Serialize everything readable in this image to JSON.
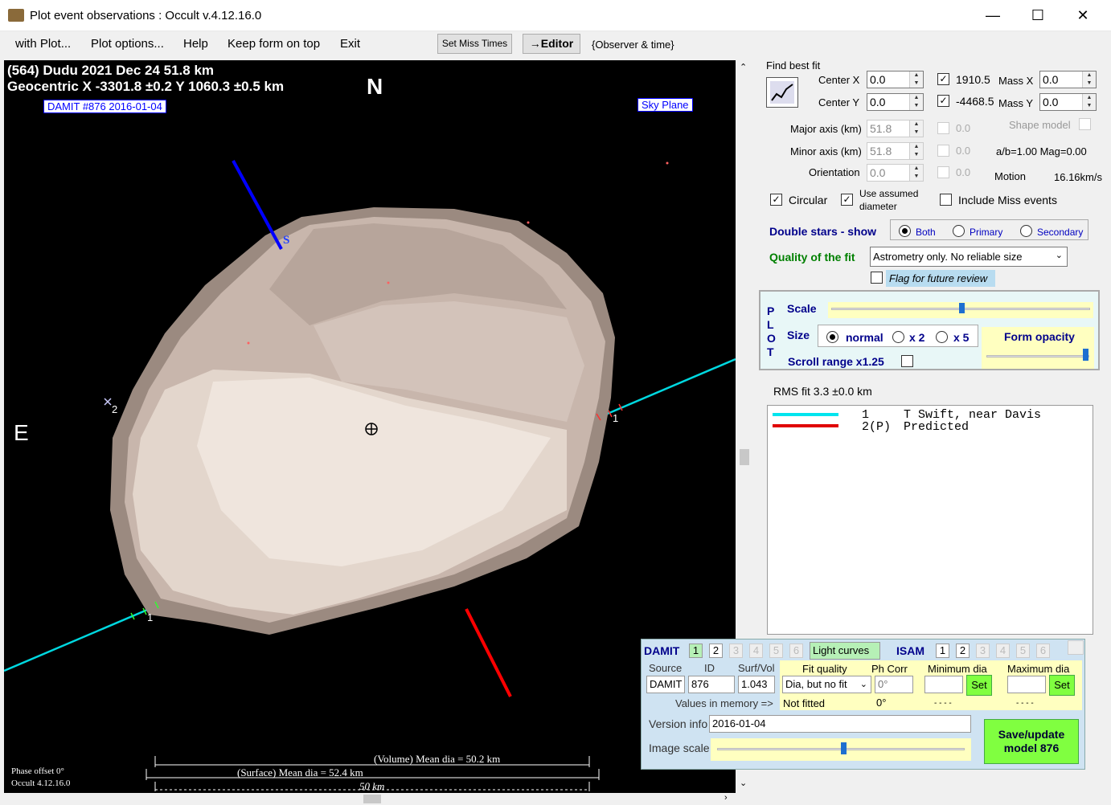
{
  "window": {
    "title": "Plot event observations : Occult v.4.12.16.0"
  },
  "menu": {
    "items": [
      "with Plot...",
      "Plot options...",
      "Help",
      "Keep form on top",
      "Exit"
    ],
    "set_miss_times": "Set Miss Times",
    "editor": "→Editor",
    "observer_time": "{Observer & time}"
  },
  "plot": {
    "title_line1": "(564) Dudu  2021 Dec 24   51.8 km",
    "title_line2": "Geocentric  X  -3301.8 ±0.2  Y 1060.3 ±0.5 km",
    "damit_label": "DAMIT #876 2016-01-04",
    "sky_plane": "Sky Plane",
    "north": "N",
    "east": "E",
    "south_marker": "S",
    "chord_label_1a": "1",
    "chord_label_1b": "1",
    "star_label": "2",
    "volume_dia": "(Volume) Mean dia = 50.2 km",
    "surface_dia": "(Surface) Mean dia = 52.4 km",
    "scale_bar": "50 km",
    "phase_offset": "Phase offset 0°",
    "occult_version": "Occult 4.12.16.0"
  },
  "fit": {
    "find_best_fit": "Find best fit",
    "center_x_label": "Center X",
    "center_x": "0.0",
    "center_y_label": "Center Y",
    "center_y": "0.0",
    "val_x": "1910.5",
    "val_y": "-4468.5",
    "mass_x_label": "Mass X",
    "mass_x": "0.0",
    "mass_y_label": "Mass Y",
    "mass_y": "0.0",
    "major_label": "Major axis (km)",
    "major": "51.8",
    "minor_label": "Minor axis (km)",
    "minor": "51.8",
    "orient_label": "Orientation",
    "orient": "0.0",
    "d1": "0.0",
    "d2": "0.0",
    "d3": "0.0",
    "shape_model": "Shape model",
    "ab_ratio": "a/b=1.00  Mag=0.00",
    "motion_label": "Motion",
    "motion": "16.16km/s",
    "circular": "Circular",
    "use_assumed": "Use assumed",
    "diameter": "diameter",
    "include_miss": "Include Miss events",
    "double_stars": "Double stars - show",
    "both": "Both",
    "primary": "Primary",
    "secondary": "Secondary",
    "quality_label": "Quality of the fit",
    "quality_value": "Astrometry only. No reliable size",
    "flag_review": "Flag for future review"
  },
  "plotctl": {
    "plot_letters": [
      "P",
      "L",
      "O",
      "T"
    ],
    "scale": "Scale",
    "size": "Size",
    "normal": "normal",
    "x2": "x 2",
    "x5": "x 5",
    "form_opacity": "Form opacity",
    "scroll_range": "Scroll range x1.25"
  },
  "rms": "RMS fit 3.3 ±0.0 km",
  "legend": [
    {
      "color": "#00e5ee",
      "num": "1",
      "text": "T Swift, near Davis"
    },
    {
      "color": "#e00000",
      "num": "2(P)",
      "text": "Predicted"
    }
  ],
  "damit": {
    "damit_label": "DAMIT",
    "isam_label": "ISAM",
    "light_curves": "Light curves",
    "nums": [
      "1",
      "2",
      "3",
      "4",
      "5",
      "6"
    ],
    "source_label": "Source",
    "id_label": "ID",
    "surfvol_label": "Surf/Vol",
    "fitq_label": "Fit quality",
    "phcorr_label": "Ph Corr",
    "mindia_label": "Minimum dia",
    "maxdia_label": "Maximum dia",
    "source": "DAMIT",
    "id": "876",
    "surfvol": "1.043",
    "fitq": "Dia, but no fit",
    "phcorr": "0°",
    "set": "Set",
    "values_mem": "Values in memory =>",
    "not_fitted": "Not fitted",
    "phcorr_mem": "0°",
    "dashes": "- - - -",
    "version_label": "Version info",
    "version": "2016-01-04",
    "image_scale": "Image scale",
    "save_btn": "Save/update model 876"
  }
}
